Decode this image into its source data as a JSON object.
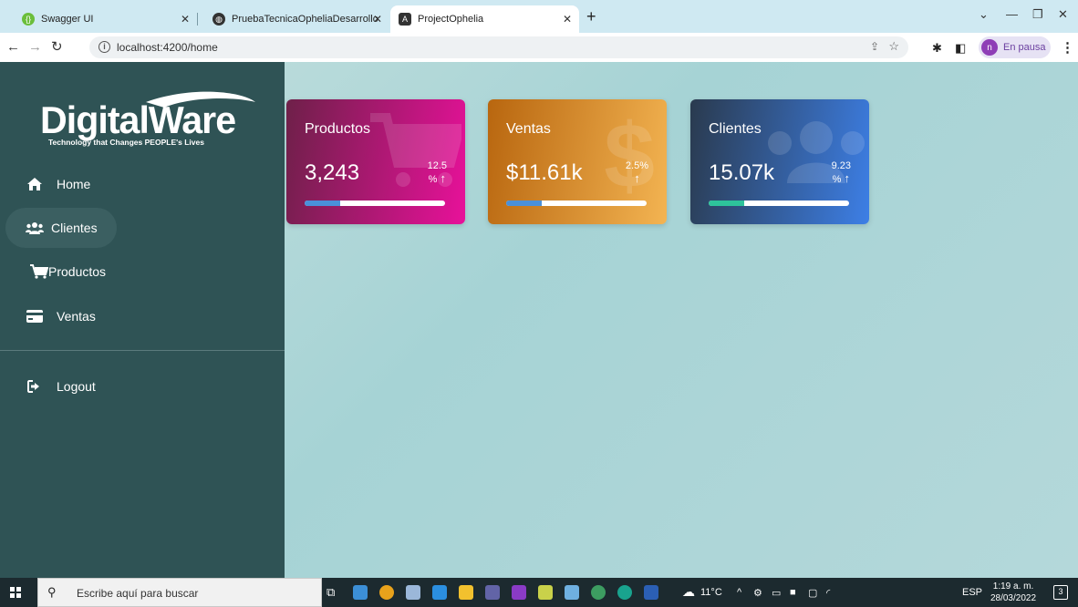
{
  "browser": {
    "tabs": [
      {
        "title": "Swagger UI",
        "icon": "swagger-icon",
        "color": "#6bbe3b"
      },
      {
        "title": "PruebaTecnicaOpheliaDesarrollo",
        "icon": "globe-icon",
        "color": "#333333"
      },
      {
        "title": "ProjectOphelia",
        "icon": "angular-icon",
        "color": "#333333"
      }
    ],
    "url": "localhost:4200/home",
    "profile_initial": "n",
    "profile_status": "En pausa"
  },
  "app": {
    "logo": {
      "brand": "DigitalWare",
      "tagline": "Technology that Changes PEOPLE's Lives"
    },
    "menu": [
      {
        "label": "Home",
        "icon": "home-icon"
      },
      {
        "label": "Clientes",
        "icon": "users-icon"
      },
      {
        "label": "Productos",
        "icon": "cart-icon"
      },
      {
        "label": "Ventas",
        "icon": "credit-card-icon"
      }
    ],
    "logout_label": "Logout",
    "cards": [
      {
        "title": "Productos",
        "value": "3,243",
        "pct_line1": "12.5",
        "pct_line2": "%",
        "progress": 0.25,
        "gradient": [
          "#6e2049",
          "#e8119a"
        ],
        "fill_color": "#4a90d9"
      },
      {
        "title": "Ventas",
        "value": "$11.61k",
        "pct_line1": "2.5%",
        "pct_line2": "",
        "progress": 0.25,
        "gradient": [
          "#b8660f",
          "#f3b452"
        ],
        "fill_color": "#4a90d9"
      },
      {
        "title": "Clientes",
        "value": "15.07k",
        "pct_line1": "9.23",
        "pct_line2": "%",
        "progress": 0.25,
        "gradient": [
          "#2a3a4e",
          "#3d7fe6"
        ],
        "fill_color": "#2ec39b"
      }
    ]
  },
  "taskbar": {
    "search_placeholder": "Escribe aquí para buscar",
    "temperature": "11°C",
    "language": "ESP",
    "time": "1:19 a. m.",
    "date": "28/03/2022",
    "notifications": "3"
  }
}
